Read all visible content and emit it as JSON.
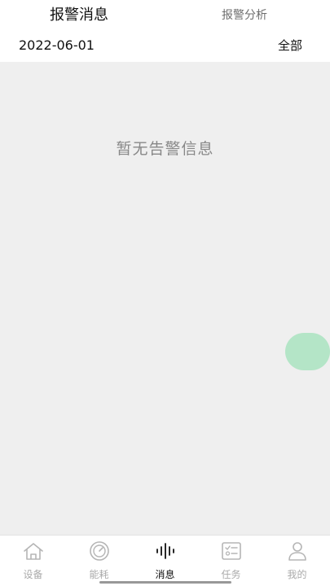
{
  "header": {
    "tabs": [
      {
        "label": "报警消息"
      },
      {
        "label": "报警分析"
      }
    ],
    "date": "2022-06-01",
    "filter": "全部"
  },
  "empty_state": {
    "message": "暂无告警信息"
  },
  "fab": {
    "color": "#a9e3bf"
  },
  "nav": {
    "items": [
      {
        "label": "设备",
        "icon": "home-icon"
      },
      {
        "label": "能耗",
        "icon": "gauge-icon"
      },
      {
        "label": "消息",
        "icon": "waveform-icon"
      },
      {
        "label": "任务",
        "icon": "checklist-icon"
      },
      {
        "label": "我的",
        "icon": "user-icon"
      }
    ],
    "active_index": 2
  }
}
